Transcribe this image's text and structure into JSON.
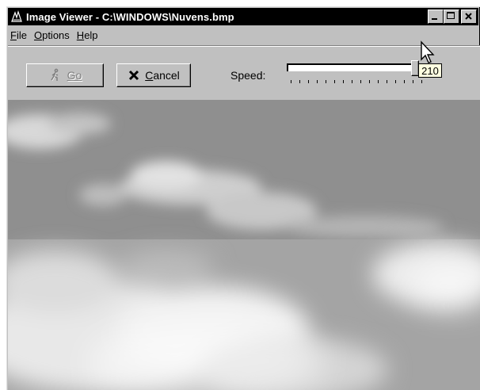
{
  "window": {
    "title": "Image Viewer - C:\\WINDOWS\\Nuvens.bmp"
  },
  "menu": {
    "file": {
      "accel": "F",
      "rest": "ile"
    },
    "options": {
      "accel": "O",
      "rest": "ptions"
    },
    "help": {
      "accel": "H",
      "rest": "elp"
    }
  },
  "toolbar": {
    "go_label": "Go",
    "cancel_label_accel": "C",
    "cancel_label_rest": "ancel",
    "speed_label": "Speed:",
    "speed_value": 210,
    "speed_tooltip": "210",
    "speed_fraction": 0.95
  },
  "icons": {
    "app": "image-viewer-app-icon",
    "go": "walking-figure-icon",
    "cancel": "x-icon",
    "cursor": "mouse-pointer-icon"
  },
  "colors": {
    "titlebar": "#000000",
    "face": "#c0c0c0",
    "tooltip": "#ffffe1",
    "sky": "#9a9a9a"
  }
}
